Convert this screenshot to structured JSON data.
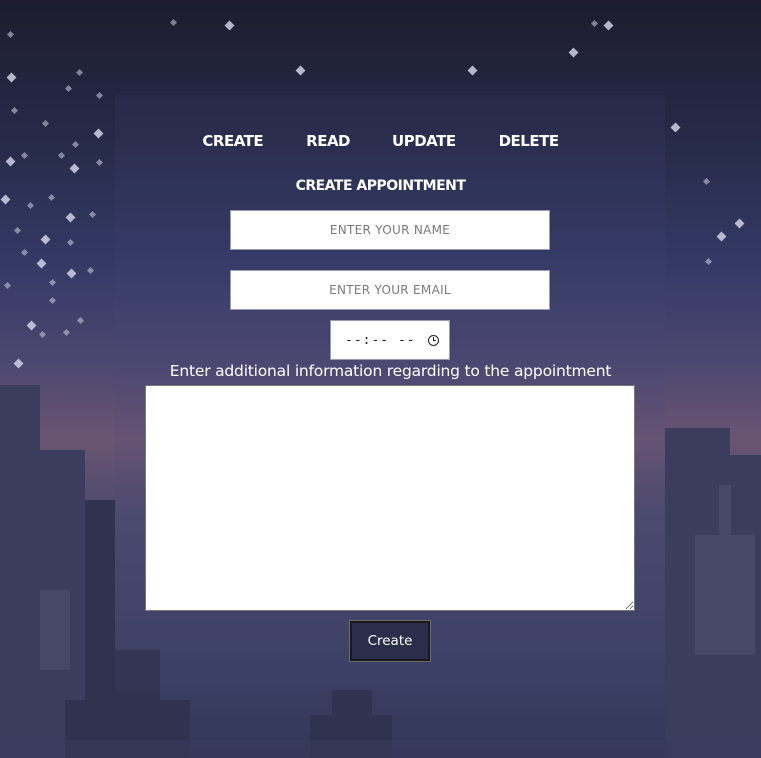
{
  "nav": {
    "items": [
      {
        "label": "CREATE"
      },
      {
        "label": "READ"
      },
      {
        "label": "UPDATE"
      },
      {
        "label": "DELETE"
      }
    ]
  },
  "form": {
    "title": "CREATE APPOINTMENT",
    "name_placeholder": "ENTER YOUR NAME",
    "email_placeholder": "ENTER YOUR EMAIL",
    "time_value": "--:-- --",
    "info_label": "Enter additional information regarding to the appointment",
    "submit_label": "Create"
  },
  "colors": {
    "text": "#ffffff",
    "button_bg": "#2b2e4a",
    "sky_top": "#1c1c2e",
    "sky_glow": "#6a5472"
  },
  "icons": [
    "clock-icon",
    "resize-handle-icon"
  ]
}
